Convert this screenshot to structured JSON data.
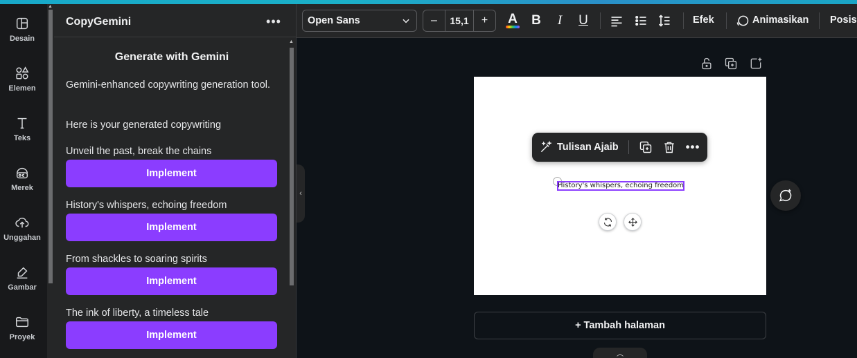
{
  "rail": {
    "items": [
      {
        "label": "Desain",
        "icon": "layout-icon"
      },
      {
        "label": "Elemen",
        "icon": "shapes-icon"
      },
      {
        "label": "Teks",
        "icon": "text-icon"
      },
      {
        "label": "Merek",
        "icon": "brand-icon"
      },
      {
        "label": "Unggahan",
        "icon": "upload-cloud-icon"
      },
      {
        "label": "Gambar",
        "icon": "draw-icon"
      },
      {
        "label": "Proyek",
        "icon": "folder-icon"
      }
    ]
  },
  "panel": {
    "title": "CopyGemini",
    "more": "•••",
    "heading": "Generate with Gemini",
    "description": "Gemini-enhanced copywriting generation tool.",
    "generated_label": "Here is your generated copywriting",
    "button_label": "Implement",
    "copies": [
      "Unveil the past, break the chains",
      "History's whispers, echoing freedom",
      "From shackles to soaring spirits",
      "The ink of liberty, a timeless tale"
    ]
  },
  "toolbar": {
    "font": "Open Sans",
    "font_size": "15,1",
    "minus": "–",
    "plus": "+",
    "color_letter": "A",
    "bold": "B",
    "italic": "I",
    "underline": "U",
    "effects": "Efek",
    "animate": "Animasikan",
    "position": "Posisi"
  },
  "canvas": {
    "context_ai": "Tulisan Ajaib",
    "selected_text": "History's whispers, echoing freedom",
    "add_page": "+ Tambah halaman"
  },
  "colors": {
    "accent": "#8b3dff",
    "panel": "#252627",
    "rail": "#18191b",
    "canvas_bg": "#0e1318"
  }
}
